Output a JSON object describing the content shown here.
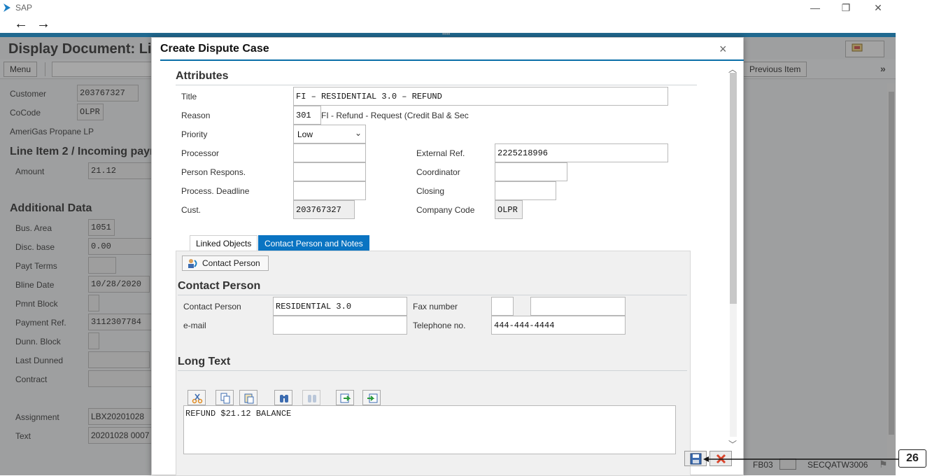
{
  "window": {
    "app_title": "SAP",
    "minimize": "—",
    "restore": "❐",
    "close": "✕"
  },
  "nav": {
    "back": "←",
    "forward": "→"
  },
  "background": {
    "title": "Display Document: Li",
    "menu_label": "Menu",
    "previous_item": "Previous Item",
    "more": "»",
    "customer": {
      "label": "Customer",
      "value": "203767327"
    },
    "cocode": {
      "label": "CoCode",
      "value": "OLPR"
    },
    "company_name": "AmeriGas Propane LP",
    "line_item_heading": "Line Item 2 / Incoming payr",
    "amount": {
      "label": "Amount",
      "value": "21.12"
    },
    "additional_heading": "Additional Data",
    "fields": [
      {
        "label": "Bus. Area",
        "value": "1051"
      },
      {
        "label": "Disc. base",
        "value": "0.00"
      },
      {
        "label": "Payt Terms",
        "value": ""
      },
      {
        "label": "Bline Date",
        "value": "10/28/2020"
      },
      {
        "label": "Pmnt Block",
        "value": ""
      },
      {
        "label": "Payment Ref.",
        "value": "3112307784"
      },
      {
        "label": "Dunn. Block",
        "value": ""
      },
      {
        "label": "Last Dunned",
        "value": ""
      },
      {
        "label": "Contract",
        "value": ""
      }
    ],
    "assignment": {
      "label": "Assignment",
      "value": "LBX20201028"
    },
    "text": {
      "label": "Text",
      "value": "20201028 0007"
    },
    "status": {
      "transaction": "FB03",
      "server": "SECQATW3006"
    }
  },
  "dialog": {
    "title": "Create Dispute Case",
    "close": "×",
    "attributes_heading": "Attributes",
    "title_field": {
      "label": "Title",
      "value": "FI – RESIDENTIAL 3.0 – REFUND"
    },
    "reason": {
      "label": "Reason",
      "code": "301",
      "text": "FI - Refund - Request (Credit Bal & Sec"
    },
    "priority": {
      "label": "Priority",
      "value": "Low"
    },
    "processor": {
      "label": "Processor",
      "value": ""
    },
    "person_respons": {
      "label": "Person Respons.",
      "value": ""
    },
    "process_deadline": {
      "label": "Process. Deadline",
      "value": ""
    },
    "cust": {
      "label": "Cust.",
      "value": "203767327"
    },
    "external_ref": {
      "label": "External Ref.",
      "value": "2225218996"
    },
    "coordinator": {
      "label": "Coordinator",
      "value": ""
    },
    "closing": {
      "label": "Closing",
      "value": ""
    },
    "company_code": {
      "label": "Company Code",
      "value": "OLPR"
    },
    "tabs": [
      {
        "label": "Linked Objects",
        "active": false
      },
      {
        "label": "Contact Person and Notes",
        "active": true
      }
    ],
    "contact_button": "Contact Person",
    "contact_heading": "Contact Person",
    "contact_person": {
      "label": "Contact Person",
      "value": "RESIDENTIAL 3.0"
    },
    "email": {
      "label": "e-mail",
      "value": ""
    },
    "fax": {
      "label": "Fax number",
      "value1": "",
      "value2": ""
    },
    "telephone": {
      "label": "Telephone no.",
      "value": "444-444-4444"
    },
    "long_text_heading": "Long Text",
    "long_text_value": "REFUND $21.12 BALANCE"
  },
  "callout": {
    "label": "26"
  },
  "colors": {
    "accent": "#0a8fd6",
    "tab_active": "#0a74c2",
    "cancel": "#d9442b"
  }
}
